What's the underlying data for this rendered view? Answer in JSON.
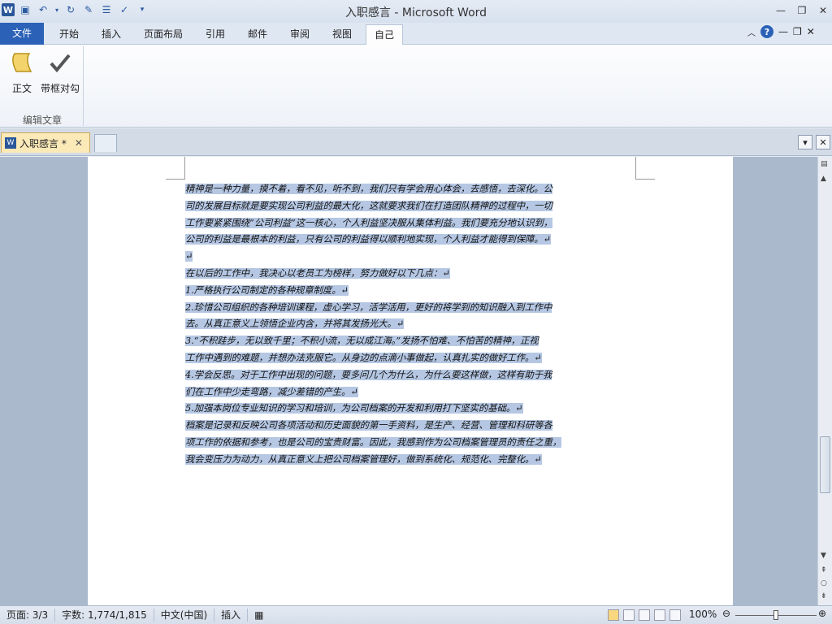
{
  "window": {
    "title": "入职感言 - Microsoft Word"
  },
  "ribbon_tabs": [
    "文件",
    "开始",
    "插入",
    "页面布局",
    "引用",
    "邮件",
    "审阅",
    "视图",
    "自己"
  ],
  "ribbon": {
    "buttons": [
      "正文",
      "带框对勾"
    ],
    "group_label": "编辑文章"
  },
  "document_tab": {
    "name": "入职感言 *"
  },
  "document": {
    "lines": [
      "精神是一种力量，摸不着，看不见，听不到，我们只有学会用心体会，去感悟，去深化。公",
      "司的发展目标就是要实现公司利益的最大化，这就要求我们在打造团队精神的过程中，一切",
      "工作要紧紧围绕“公司利益”这一核心，个人利益坚决服从集体利益。我们要充分地认识到，",
      "公司的利益是最根本的利益，只有公司的利益得以顺利地实现，个人利益才能得到保障。↵",
      "↵",
      "在以后的工作中，我决心以老员工为榜样，努力做好以下几点：↵",
      "1.严格执行公司制定的各种规章制度。↵",
      "2.珍惜公司组织的各种培训课程，虚心学习，活学活用，更好的将学到的知识融入到工作中",
      "去。从真正意义上领悟企业内含，并将其发扬光大。↵",
      "3.“不积跬步，无以致千里；不积小流，无以成江海。”发扬不怕难、不怕苦的精神，正视",
      "工作中遇到的难题，并想办法克服它。从身边的点滴小事做起，认真扎实的做好工作。↵",
      "4.学会反思。对于工作中出现的问题，要多问几个为什么，为什么要这样做，这样有助于我",
      "们在工作中少走弯路，减少差错的产生。↵",
      "5.加强本岗位专业知识的学习和培训，为公司档案的开发和利用打下坚实的基础。↵",
      "档案是记录和反映公司各项活动和历史面貌的第一手资料，是生产、经营、管理和科研等各",
      "项工作的依据和参考，也是公司的宝贵财富。因此，我感到作为公司档案管理员的责任之重，",
      "我会变压力为动力，从真正意义上把公司档案管理好，做到系统化、规范化、完整化。↵"
    ]
  },
  "status": {
    "page": "页面: 3/3",
    "words": "字数: 1,774/1,815",
    "language": "中文(中国)",
    "mode": "插入",
    "zoom": "100%"
  }
}
